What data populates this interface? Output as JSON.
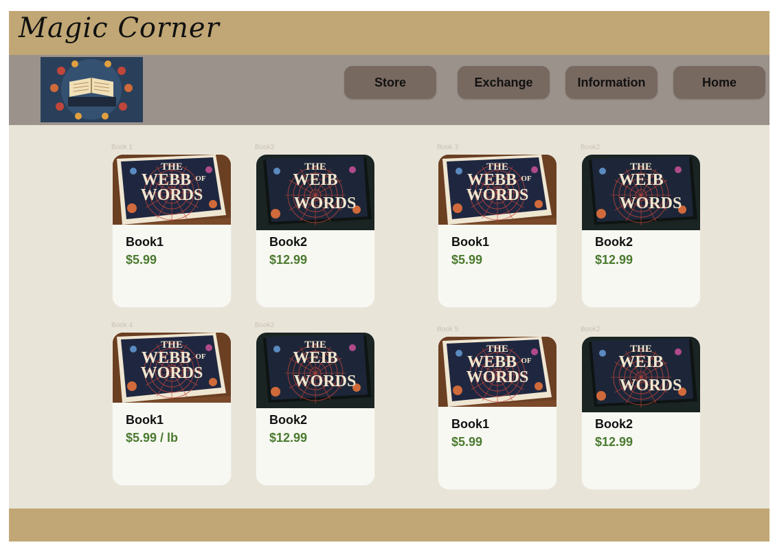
{
  "brand": {
    "title": "Magic Corner"
  },
  "nav": [
    {
      "label": "Store"
    },
    {
      "label": "Exchange"
    },
    {
      "label": "Information"
    },
    {
      "label": "Home"
    }
  ],
  "cover_text": {
    "line1": "THE",
    "line2": "WEBB",
    "line3": "OF",
    "line4": "WORDS",
    "alt_line2": "WEIB"
  },
  "cards": [
    {
      "label": "Book 1",
      "name": "Book1",
      "price": "$5.99",
      "cover": "webb"
    },
    {
      "label": "Book2",
      "name": "Book2",
      "price": "$12.99",
      "cover": "weib"
    },
    {
      "label": "Book 3",
      "name": "Book1",
      "price": "$5.99",
      "cover": "webb"
    },
    {
      "label": "Book2",
      "name": "Book2",
      "price": "$12.99",
      "cover": "weib"
    },
    {
      "label": "Book 4",
      "name": "Book1",
      "price": "$5.99 / lb",
      "cover": "webb"
    },
    {
      "label": "Book2",
      "name": "Book2",
      "price": "$12.99",
      "cover": "weib"
    },
    {
      "label": "Book 5",
      "name": "Book1",
      "price": "$5.99",
      "cover": "webb"
    },
    {
      "label": "Book2",
      "name": "Book2",
      "price": "$12.99",
      "cover": "weib"
    }
  ],
  "colors": {
    "header": "#c1a775",
    "nav": "#9a928b",
    "button": "#786960",
    "background": "#e9e4d8",
    "price": "#4a7a2e"
  }
}
